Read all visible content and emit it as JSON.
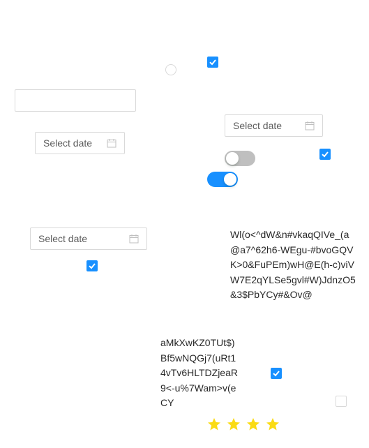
{
  "colors": {
    "primary": "#1890ff",
    "border": "#d9d9d9",
    "switch_off": "#bfbfbf",
    "star": "#fadb14"
  },
  "radio": {
    "checked": false
  },
  "checkboxes": [
    {
      "id": "cb1",
      "checked": true
    },
    {
      "id": "cb2",
      "checked": true
    },
    {
      "id": "cb3",
      "checked": true
    },
    {
      "id": "cb4",
      "checked": true
    },
    {
      "id": "cb5",
      "checked": false
    }
  ],
  "text_input": {
    "value": "",
    "placeholder": ""
  },
  "date_pickers": [
    {
      "placeholder": "Select date",
      "icon": "calendar-icon"
    },
    {
      "placeholder": "Select date",
      "icon": "calendar-icon"
    },
    {
      "placeholder": "Select date",
      "icon": "calendar-icon"
    }
  ],
  "switches": [
    {
      "checked": false
    },
    {
      "checked": true
    }
  ],
  "text_blocks": [
    "Wl(o<^dW&n#vkaqQIVe_(a@a7^62h6-WEgu-#bvoGQVK>0&FuPEm)wH@E(h-c)viVW7E2qYLSe5gvl#W)JdnzO5&3$PbYCy#&Ov@",
    "aMkXwKZ0TUt$)Bf5wNQGj7(uRt14vTv6HLTDZjeaR9<-u%7Wam>v(eCY"
  ],
  "rating": {
    "value": 4,
    "max": 4,
    "icon": "star-icon"
  }
}
